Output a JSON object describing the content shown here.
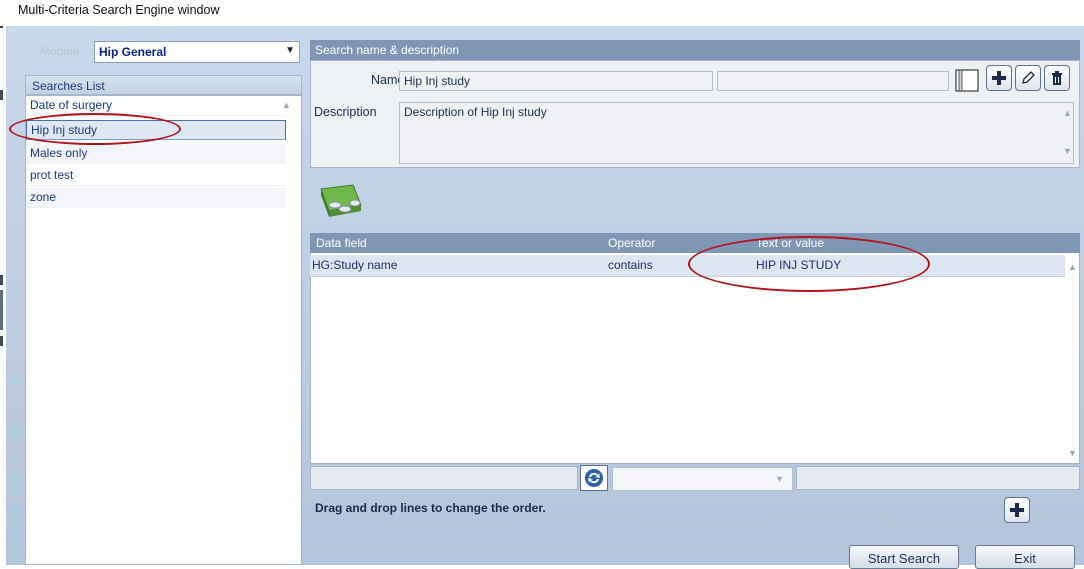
{
  "window": {
    "title": "Multi-Criteria Search Engine window"
  },
  "module": {
    "label": "Module",
    "value": "Hip General"
  },
  "searches": {
    "header": "Searches List",
    "items": [
      {
        "label": "Date of surgery"
      },
      {
        "label": "Hip Inj study"
      },
      {
        "label": "Males only"
      },
      {
        "label": "prot test"
      },
      {
        "label": "zone"
      }
    ],
    "selected": "Hip Inj study"
  },
  "search_details": {
    "header": "Search name & description",
    "name_label": "Name",
    "name_value": "Hip Inj study",
    "description_label": "Description",
    "description_value": "Description of Hip Inj study"
  },
  "grid": {
    "columns": [
      "Data field",
      "Operator",
      "Text or value"
    ],
    "rows": [
      {
        "field": "HG:Study name",
        "operator": "contains",
        "value": "HIP INJ STUDY"
      }
    ]
  },
  "hint": "Drag and drop lines to change the order.",
  "buttons": {
    "start": "Start Search",
    "exit": "Exit"
  },
  "icons": [
    "book-icon",
    "plus-icon",
    "pencil-icon",
    "trash-icon",
    "database-icon",
    "refresh-icon"
  ],
  "colors": {
    "header_bg": "#7f96b5",
    "highlight_ring": "#b3141b",
    "text_blue": "#1d3a7c"
  }
}
